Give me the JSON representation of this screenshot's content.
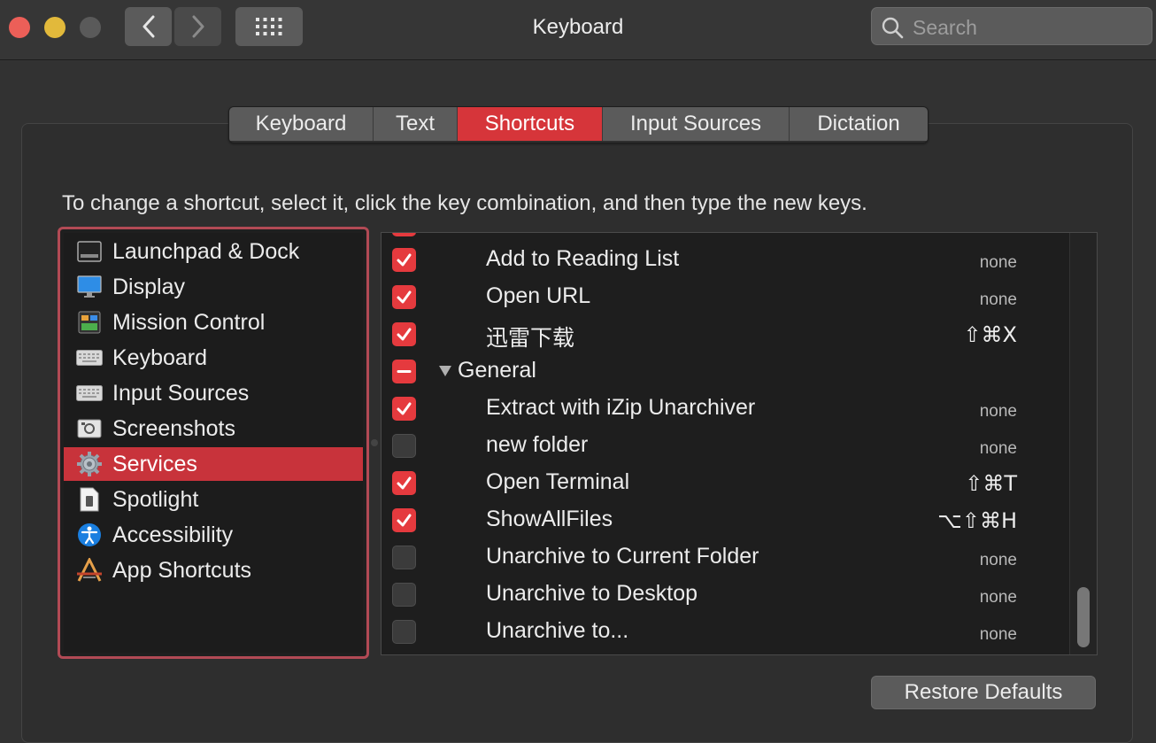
{
  "window": {
    "title": "Keyboard",
    "search_placeholder": "Search"
  },
  "tabs": [
    {
      "label": "Keyboard"
    },
    {
      "label": "Text"
    },
    {
      "label": "Shortcuts",
      "active": true
    },
    {
      "label": "Input Sources"
    },
    {
      "label": "Dictation"
    }
  ],
  "instructions": "To change a shortcut, select it, click the key combination, and then type the new keys.",
  "sidebar": {
    "items": [
      {
        "label": "Launchpad & Dock",
        "icon": "launchpad-dock-icon"
      },
      {
        "label": "Display",
        "icon": "display-icon"
      },
      {
        "label": "Mission Control",
        "icon": "mission-control-icon"
      },
      {
        "label": "Keyboard",
        "icon": "keyboard-icon"
      },
      {
        "label": "Input Sources",
        "icon": "input-sources-icon"
      },
      {
        "label": "Screenshots",
        "icon": "screenshots-icon"
      },
      {
        "label": "Services",
        "icon": "gear-icon",
        "selected": true
      },
      {
        "label": "Spotlight",
        "icon": "spotlight-icon"
      },
      {
        "label": "Accessibility",
        "icon": "accessibility-icon"
      },
      {
        "label": "App Shortcuts",
        "icon": "app-shortcuts-icon"
      }
    ]
  },
  "shortcuts": {
    "rows": [
      {
        "label": "Add to Reading List",
        "shortcut": "none",
        "checked": true
      },
      {
        "label": "Open URL",
        "shortcut": "none",
        "checked": true
      },
      {
        "label": "迅雷下载",
        "shortcut": "⇧⌘X",
        "checked": true
      },
      {
        "label": "General",
        "group": true,
        "state": "mixed"
      },
      {
        "label": "Extract with iZip Unarchiver",
        "shortcut": "none",
        "checked": true
      },
      {
        "label": "new folder",
        "shortcut": "none",
        "checked": false
      },
      {
        "label": "Open Terminal",
        "shortcut": "⇧⌘T",
        "checked": true
      },
      {
        "label": "ShowAllFiles",
        "shortcut": "⌥⇧⌘H",
        "checked": true
      },
      {
        "label": "Unarchive to Current Folder",
        "shortcut": "none",
        "checked": false
      },
      {
        "label": "Unarchive to Desktop",
        "shortcut": "none",
        "checked": false
      },
      {
        "label": "Unarchive to...",
        "shortcut": "none",
        "checked": false
      }
    ]
  },
  "restore_defaults_label": "Restore Defaults",
  "colors": {
    "accent": "#e53a3e",
    "selection": "#c8333b",
    "focus_ring": "#b24a55"
  }
}
